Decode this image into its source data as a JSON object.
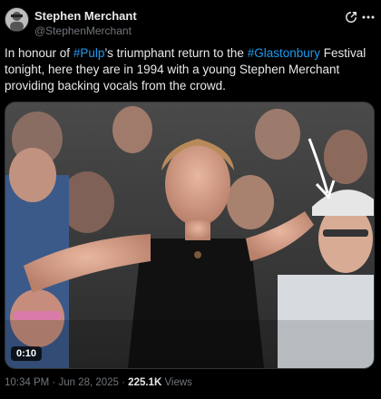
{
  "author": {
    "name": "Stephen Merchant",
    "handle": "@StephenMerchant",
    "avatar_icon": "profile-avatar"
  },
  "header_icons": [
    "grok-icon",
    "more-icon"
  ],
  "post": {
    "text_parts": {
      "p1": "In honour of ",
      "tag1": "#Pulp",
      "p2": "’s triumphant return to the ",
      "tag2": "#Glastonbury",
      "p3": " Festival tonight, here they are in 1994 with a young Stephen Merchant providing backing vocals from the crowd."
    }
  },
  "media": {
    "type": "video",
    "duration": "0:10"
  },
  "meta": {
    "timestamp": "10:34 PM · Jun 28, 2025 · ",
    "views_count": "225.1K",
    "views_label": " Views"
  },
  "colors": {
    "background": "#000000",
    "text": "#e7e9ea",
    "secondary": "#71767b",
    "link": "#1d9bf0"
  }
}
